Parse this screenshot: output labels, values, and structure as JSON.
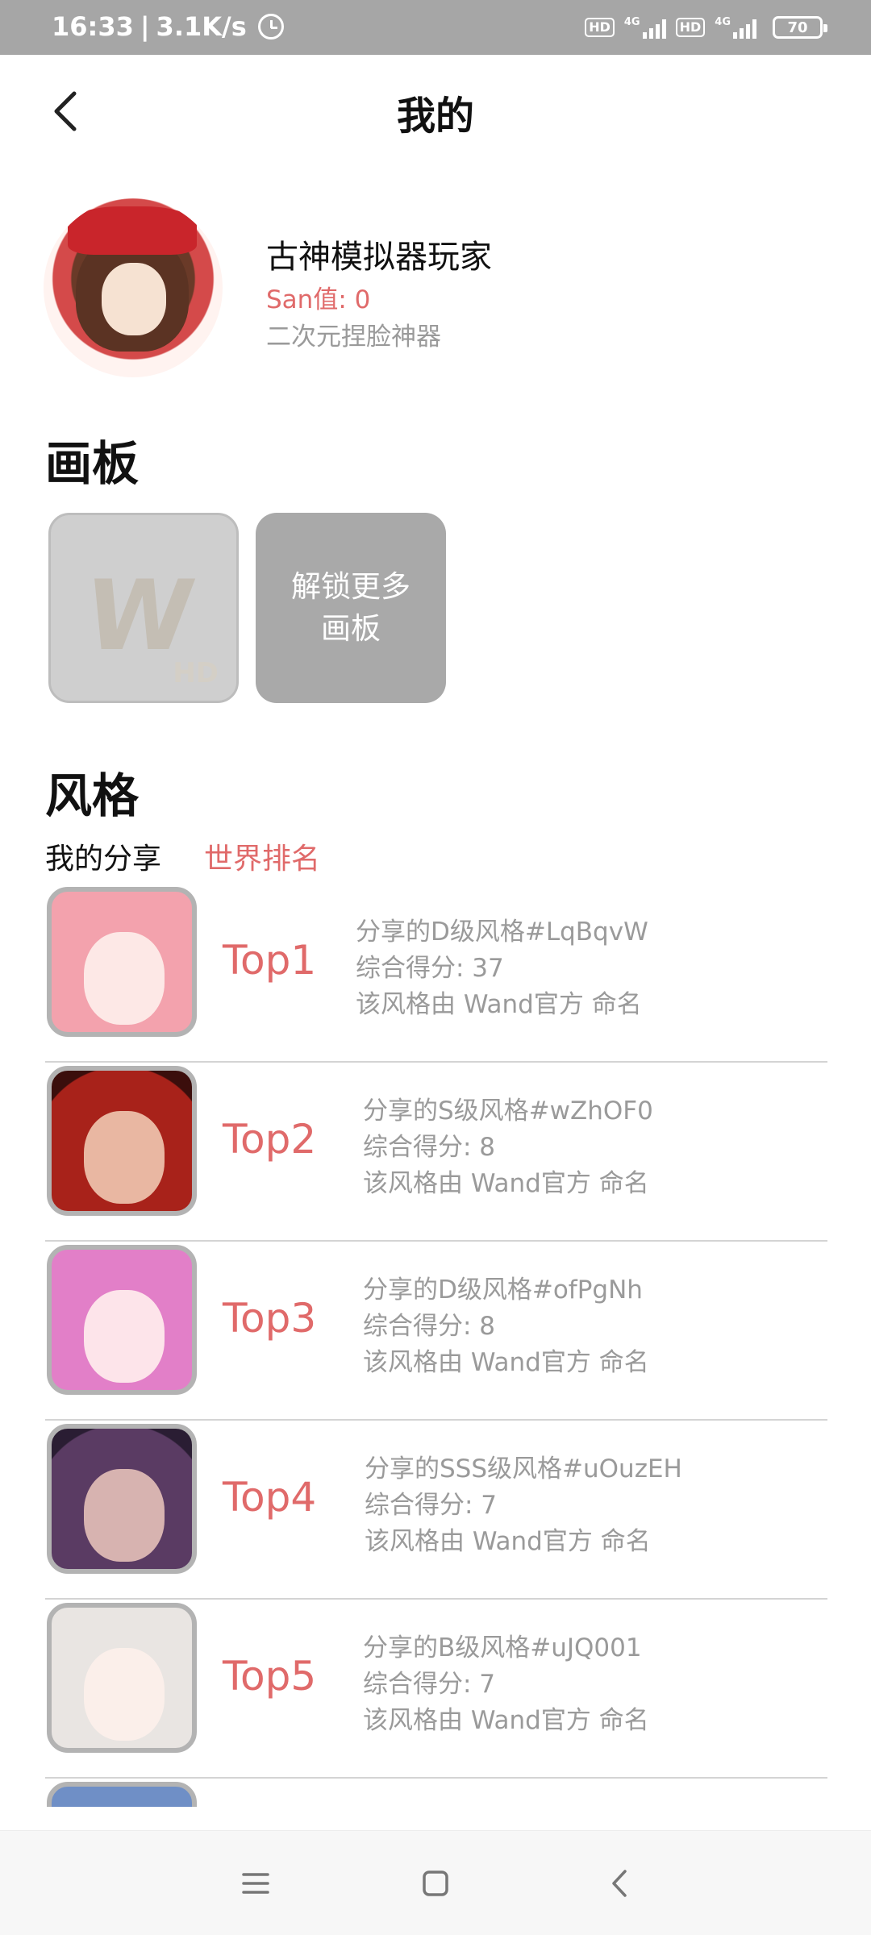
{
  "status_bar": {
    "time": "16:33",
    "separator": "|",
    "speed": "3.1K/s",
    "icons": [
      "alarm-icon",
      "hd-icon",
      "signal-4g-icon",
      "hd-icon",
      "signal-4g-icon",
      "battery-icon"
    ],
    "hd_label": "HD",
    "network_label": "4G",
    "battery_level": "70"
  },
  "header": {
    "title": "我的",
    "back_icon": "chevron-left-icon"
  },
  "profile": {
    "username": "古神模拟器玩家",
    "san_value": "San值: 0",
    "description": "二次元捏脸神器"
  },
  "canvas_section": {
    "title": "画板",
    "unlock_label_line1": "解锁更多",
    "unlock_label_line2": "画板",
    "watermark_letter": "W",
    "watermark_hd": "HD"
  },
  "style_section": {
    "title": "风格",
    "tabs": [
      {
        "label": "我的分享",
        "active": false
      },
      {
        "label": "世界排名",
        "active": true
      }
    ]
  },
  "ranking": [
    {
      "rank": "Top1",
      "title": "分享的D级风格#LqBqvW",
      "score": "综合得分: 37",
      "namer": "该风格由 Wand官方 命名"
    },
    {
      "rank": "Top2",
      "title": "分享的S级风格#wZhOF0",
      "score": "综合得分: 8",
      "namer": "该风格由 Wand官方 命名"
    },
    {
      "rank": "Top3",
      "title": "分享的D级风格#ofPgNh",
      "score": "综合得分: 8",
      "namer": "该风格由 Wand官方 命名"
    },
    {
      "rank": "Top4",
      "title": "分享的SSS级风格#uOuzEH",
      "score": "综合得分: 7",
      "namer": "该风格由 Wand官方 命名"
    },
    {
      "rank": "Top5",
      "title": "分享的B级风格#uJQ001",
      "score": "综合得分: 7",
      "namer": "该风格由 Wand官方 命名"
    }
  ],
  "colors": {
    "accent": "#e06a6a",
    "muted_text": "#9a9a9a",
    "status_bar_bg": "#a6a6a6",
    "tile_gray": "#a9a9a9"
  },
  "nav_bar": {
    "icons": [
      "menu-icon",
      "home-square-icon",
      "back-triangle-icon"
    ]
  }
}
